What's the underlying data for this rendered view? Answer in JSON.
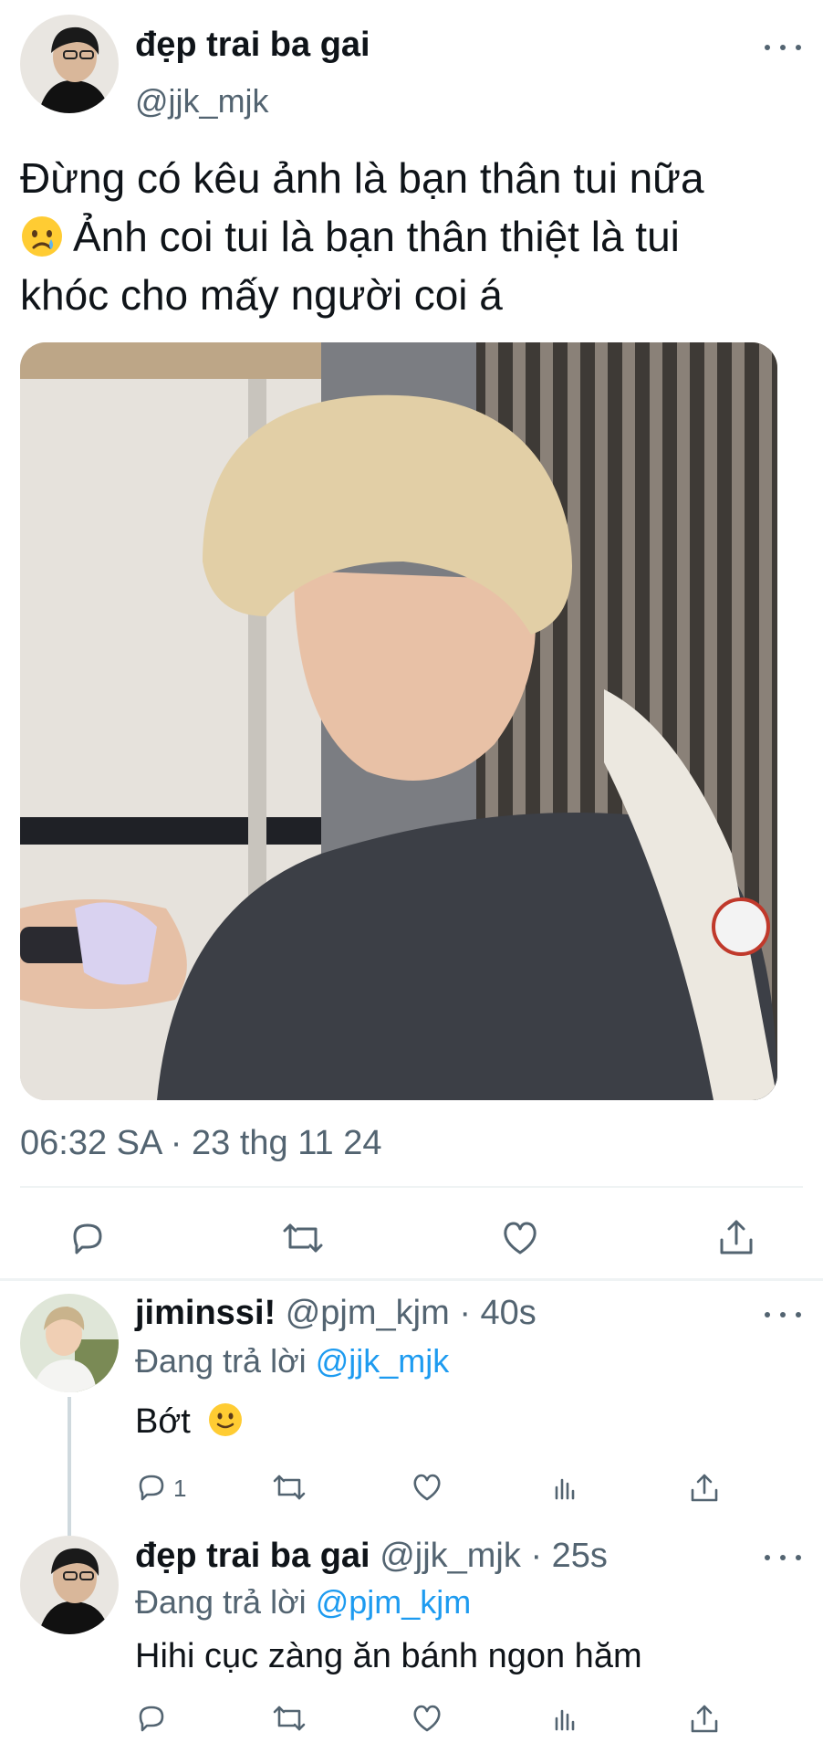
{
  "tweet": {
    "display_name": "đẹp trai ba gai",
    "handle": "@jjk_mjk",
    "text_line1": "Đừng có kêu ảnh là bạn thân tui nữa",
    "emoji": "crying-face",
    "text_line2": "Ảnh coi tui là bạn thân thiệt là tui",
    "text_line3": "khóc cho mấy người coi á",
    "timestamp": "06:32 SA · 23 thg 11 24"
  },
  "replies": [
    {
      "display_name": "jiminssi!",
      "handle": "@pjm_kjm",
      "age": "· 40s",
      "replying_prefix": "Đang trả lời",
      "replying_to": "@jjk_mjk",
      "text": "Bớt",
      "emoji": "slightly-smiling-face",
      "reply_count": "1"
    },
    {
      "display_name": "đẹp trai ba gai",
      "handle": "@jjk_mjk",
      "age": "· 25s",
      "replying_prefix": "Đang trả lời",
      "replying_to": "@pjm_kjm",
      "text": "Hihi cục zàng ăn bánh ngon hăm"
    }
  ],
  "colors": {
    "text": "#0f1419",
    "secondary": "#536471",
    "link": "#1d9bf0",
    "divider": "#eff3f4"
  }
}
